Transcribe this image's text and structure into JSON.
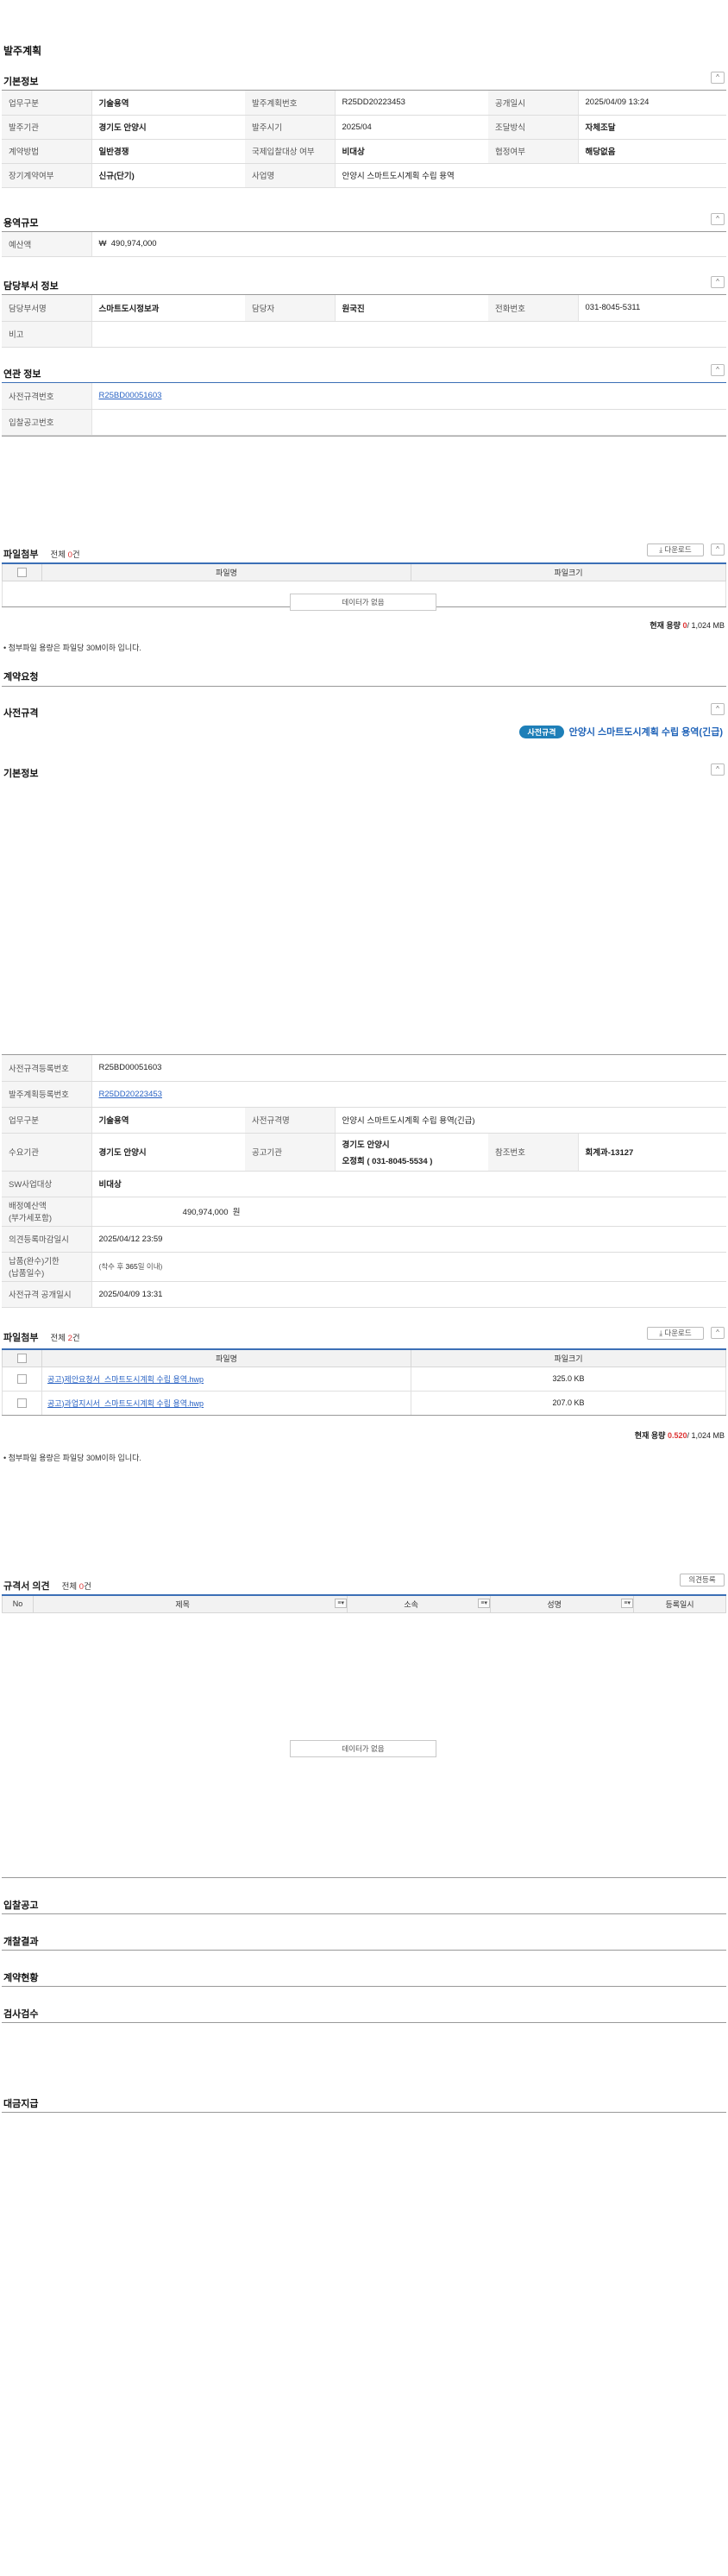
{
  "page_title": "발주계획",
  "basic": {
    "title": "기본정보",
    "rows": [
      [
        {
          "label": "업무구분",
          "value": "기술용역"
        },
        {
          "label": "발주계획번호",
          "value": "R25DD20223453"
        },
        {
          "label": "공개일시",
          "value": "2025/04/09 13:24"
        }
      ],
      [
        {
          "label": "발주기관",
          "value": "경기도 안양시"
        },
        {
          "label": "발주시기",
          "value": "2025/04"
        },
        {
          "label": "조달방식",
          "value": "자체조달"
        }
      ],
      [
        {
          "label": "계약방법",
          "value": "일반경쟁"
        },
        {
          "label": "국제입찰대상 여부",
          "value": "비대상"
        },
        {
          "label": "협정여부",
          "value": "해당없음"
        }
      ],
      {
        "label": "장기계약여부",
        "value": "신규(단기)",
        "label2": "사업명",
        "value2": "안양시 스마트도시계획 수립 용역"
      }
    ]
  },
  "scale": {
    "title": "용역규모",
    "label": "예산액",
    "currency": "₩",
    "value": "490,974,000"
  },
  "dept": {
    "title": "담당부서 정보",
    "labels": [
      "담당부서명",
      "담당자",
      "전화번호"
    ],
    "values": [
      "스마트도시정보과",
      "원국진",
      "031-8045-5311"
    ],
    "note_label": "비고",
    "note_value": ""
  },
  "related": {
    "title": "연관 정보",
    "pre_label": "사전규격번호",
    "pre_value": "R25BD00051603",
    "bid_label": "입찰공고번호",
    "bid_value": ""
  },
  "files1": {
    "title": "파일첨부",
    "count_prefix": "전체",
    "count": "0",
    "count_suffix": "건",
    "download": "⤓ 다운로드",
    "col_name": "파일명",
    "col_size": "파일크기",
    "nodata": "데이터가 없음",
    "cap_label": "현재 용량",
    "cap_value": "0",
    "cap_total": "/ 1,024 MB",
    "note": "• 첨부파일 용량은 파일당 30M이하 입니다."
  },
  "contract_req": "계약요청",
  "pre_spec": {
    "title": "사전규격",
    "badge": "사전규격",
    "name": "안양시 스마트도시계획 수립 용역(긴급)",
    "basic_title": "기본정보",
    "reg_label": "사전규격등록번호",
    "reg_value": "R25BD00051603",
    "plan_label": "발주계획등록번호",
    "plan_value": "R25DD20223453",
    "biz_label": "업무구분",
    "biz_value": "기술용역",
    "name_label": "사전규격명",
    "name_value": "안양시 스마트도시계획 수립 용역(긴급)",
    "dem_label": "수요기관",
    "dem_value": "경기도 안양시",
    "pub_label": "공고기관",
    "pub_value1": "경기도 안양시",
    "pub_value2": "오정희 ( 031-8045-5534 )",
    "ref_label": "참조번호",
    "ref_value": "회계과-13127",
    "sw_label": "SW사업대상",
    "sw_value": "비대상",
    "budget_label1": "배정예산액",
    "budget_label2": "(부가세포함)",
    "budget_value": "490,974,000",
    "budget_unit": "원",
    "opinion_label": "의견등록마감일시",
    "opinion_value": "2025/04/12 23:59",
    "deliv_label1": "납품(완수)기한",
    "deliv_label2": "(납품일수)",
    "deliv_value1": "(착수 후",
    "deliv_value2": "365",
    "deliv_value3": "일 이내)",
    "open_label": "사전규격 공개일시",
    "open_value": "2025/04/09 13:31"
  },
  "files2": {
    "title": "파일첨부",
    "count_prefix": "전체",
    "count": "2",
    "count_suffix": "건",
    "download": "⤓ 다운로드",
    "col_name": "파일명",
    "col_size": "파일크기",
    "rows": [
      {
        "name": "공고)제안요청서_스마트도시계획 수립 용역.hwp",
        "size": "325.0 KB"
      },
      {
        "name": "공고)과업지시서_스마트도시계획 수립 용역.hwp",
        "size": "207.0 KB"
      }
    ],
    "cap_label": "현재 용량",
    "cap_value": "0.520",
    "cap_total": "/ 1,024 MB",
    "note": "• 첨부파일 용량은 파일당 30M이하 입니다."
  },
  "opinions": {
    "title": "규격서 의견",
    "count_prefix": "전체",
    "count": "0",
    "count_suffix": "건",
    "button": "의견등록",
    "cols": [
      "No",
      "제목",
      "소속",
      "성명",
      "등록일시"
    ],
    "sort": "≡▾",
    "nodata": "데이터가 없음"
  },
  "tail_sections": [
    "입찰공고",
    "개찰결과",
    "계약현황",
    "검사검수",
    "대금지급"
  ],
  "toggle_icon": "^"
}
